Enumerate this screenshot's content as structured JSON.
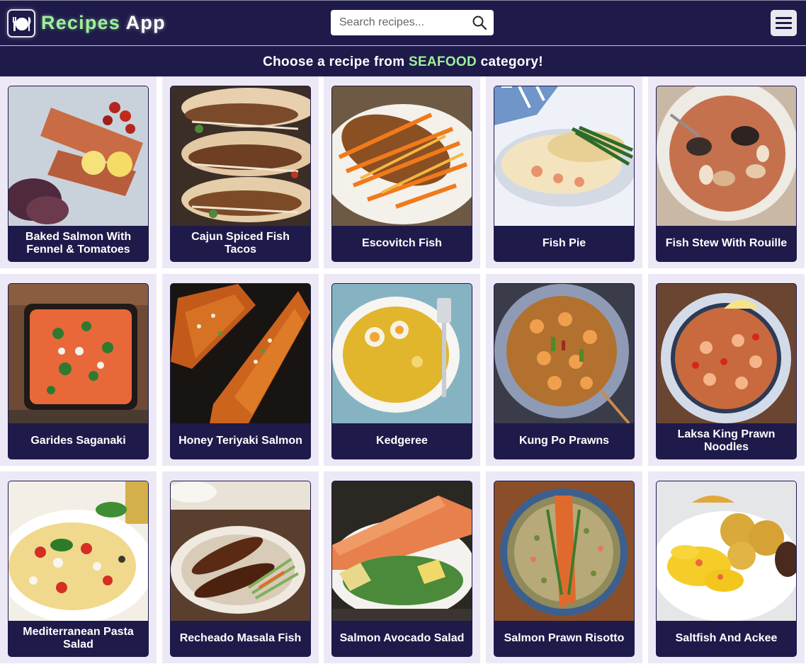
{
  "app": {
    "title_part1": "Recipes",
    "title_part2": "App"
  },
  "search": {
    "placeholder": "Search recipes..."
  },
  "banner": {
    "prefix": "Choose a recipe from ",
    "category": "SEAFOOD",
    "suffix": " category!"
  },
  "recipes": [
    {
      "name": "Baked Salmon With Fennel & Tomatoes",
      "image": "salmon-fillet-lemon"
    },
    {
      "name": "Cajun Spiced Fish Tacos",
      "image": "fish-tacos"
    },
    {
      "name": "Escovitch Fish",
      "image": "fried-fish-carrots"
    },
    {
      "name": "Fish Pie",
      "image": "fish-pie-beans"
    },
    {
      "name": "Fish Stew With Rouille",
      "image": "seafood-stew"
    },
    {
      "name": "Garides Saganaki",
      "image": "prawns-tomato-pan"
    },
    {
      "name": "Honey Teriyaki Salmon",
      "image": "glazed-salmon"
    },
    {
      "name": "Kedgeree",
      "image": "rice-egg-plate"
    },
    {
      "name": "Kung Po Prawns",
      "image": "prawns-peanuts"
    },
    {
      "name": "Laksa King Prawn Noodles",
      "image": "prawn-noodle-bowl"
    },
    {
      "name": "Mediterranean Pasta Salad",
      "image": "pasta-salad"
    },
    {
      "name": "Recheado Masala Fish",
      "image": "masala-fish"
    },
    {
      "name": "Salmon Avocado Salad",
      "image": "salmon-avocado-salad"
    },
    {
      "name": "Salmon Prawn Risotto",
      "image": "salmon-risotto"
    },
    {
      "name": "Saltfish And Ackee",
      "image": "saltfish-ackee"
    }
  ],
  "colors": {
    "navy": "#1e1a4a",
    "accent_green": "#9ef09a",
    "tile_bg": "#ede8f6"
  }
}
